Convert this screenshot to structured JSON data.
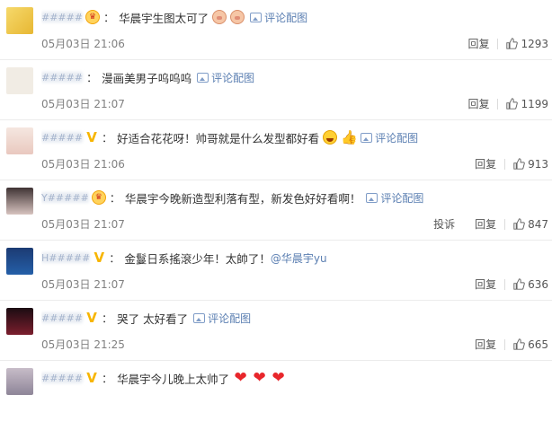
{
  "comments": [
    {
      "username": "#####",
      "badge": "vip",
      "text": "华晨宇生图太可了",
      "emojis": [
        "pig-emoji",
        "pig-emoji"
      ],
      "pic_label": "评论配图",
      "time": "05月03日 21:06",
      "report_label": "",
      "reply_label": "回复",
      "likes": "1293",
      "avatar": "av-a"
    },
    {
      "username": "#####",
      "badge": "",
      "text": "漫画美男子呜呜呜",
      "emojis": [],
      "pic_label": "评论配图",
      "time": "05月03日 21:07",
      "report_label": "",
      "reply_label": "回复",
      "likes": "1199",
      "avatar": "av-b"
    },
    {
      "username": "#####",
      "badge": "v",
      "text": "好适合花花呀！帅哥就是什么发型都好看",
      "emojis": [
        "grin-emoji",
        "thumbs-up-emoji"
      ],
      "pic_label": "评论配图",
      "time": "05月03日 21:06",
      "report_label": "",
      "reply_label": "回复",
      "likes": "913",
      "avatar": "av-c"
    },
    {
      "username": "Y#####",
      "badge": "vip",
      "text": "华晨宇今晚新造型利落有型，新发色好好看啊！",
      "emojis": [],
      "pic_label": "评论配图",
      "time": "05月03日 21:07",
      "report_label": "投诉",
      "reply_label": "回复",
      "likes": "847",
      "avatar": "av-d"
    },
    {
      "username": "H#####",
      "badge": "v",
      "text": "金鬘日系搖滾少年！太帥了！",
      "mention": "@华晨宇yu",
      "emojis": [],
      "pic_label": "",
      "time": "05月03日 21:07",
      "report_label": "",
      "reply_label": "回复",
      "likes": "636",
      "avatar": "av-e"
    },
    {
      "username": "#####",
      "badge": "v",
      "text": "哭了 太好看了",
      "emojis": [],
      "pic_label": "评论配图",
      "time": "05月03日 21:25",
      "report_label": "",
      "reply_label": "回复",
      "likes": "665",
      "avatar": "av-f"
    },
    {
      "username": "#####",
      "badge": "v",
      "text": "华晨宇今儿晚上太帅了",
      "emojis": [
        "heart-emoji",
        "heart-emoji",
        "heart-emoji"
      ],
      "pic_label": "",
      "time": "",
      "report_label": "",
      "reply_label": "",
      "likes": "",
      "avatar": "av-g"
    }
  ],
  "colors": {
    "link": "#5b7fb2",
    "verified": "#f7b500",
    "heart": "#e8262b"
  }
}
